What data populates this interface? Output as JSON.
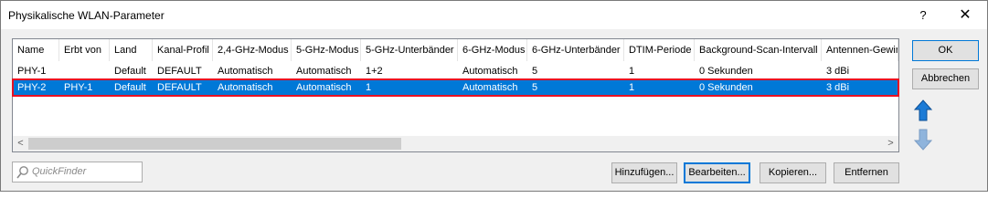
{
  "window": {
    "title": "Physikalische WLAN-Parameter",
    "help_label": "?",
    "close_label": "✕"
  },
  "table": {
    "columns": [
      "Name",
      "Erbt von",
      "Land",
      "Kanal-Profil",
      "2,4-GHz-Modus",
      "5-GHz-Modus",
      "5-GHz-Unterbänder",
      "6-GHz-Modus",
      "6-GHz-Unterbänder",
      "DTIM-Periode",
      "Background-Scan-Intervall",
      "Antennen-Gewinn"
    ],
    "rows": [
      [
        "PHY-1",
        "",
        "Default",
        "DEFAULT",
        "Automatisch",
        "Automatisch",
        "1+2",
        "Automatisch",
        "5",
        "1",
        "0 Sekunden",
        "3 dBi"
      ],
      [
        "PHY-2",
        "PHY-1",
        "Default",
        "DEFAULT",
        "Automatisch",
        "Automatisch",
        "1",
        "Automatisch",
        "5",
        "1",
        "0 Sekunden",
        "3 dBi"
      ]
    ],
    "selected_row": 1
  },
  "buttons": {
    "ok": "OK",
    "cancel": "Abbrechen",
    "add": "Hinzufügen...",
    "edit": "Bearbeiten...",
    "copy": "Kopieren...",
    "remove": "Entfernen"
  },
  "quickfinder": {
    "placeholder": "QuickFinder"
  },
  "scrollbar": {
    "left_arrow": "<",
    "right_arrow": ">"
  },
  "icons": {
    "move_up": "arrow-up-icon",
    "move_down": "arrow-down-icon",
    "search": "search-icon"
  },
  "colors": {
    "selection": "#0078d7",
    "selection_outline": "#e81123",
    "arrow_blue": "#1c7bd6"
  }
}
